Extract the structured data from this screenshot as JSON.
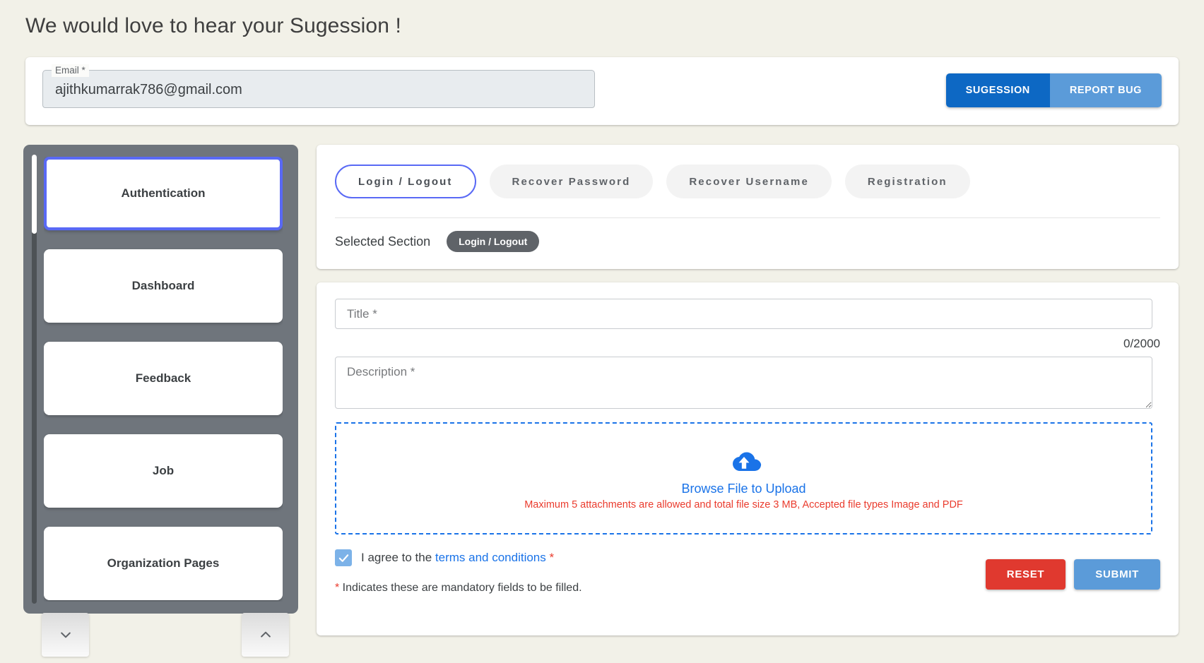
{
  "header": {
    "title": "We would love to hear your Sugession !"
  },
  "email_field": {
    "label": "Email *",
    "value": "ajithkumarrak786@gmail.com"
  },
  "mode_toggle": {
    "suggestion_label": "SUGESSION",
    "report_bug_label": "REPORT BUG",
    "active": "SUGESSION",
    "active_color": "#0d68c4",
    "inactive_color": "#5b9bd9"
  },
  "sidebar": {
    "items": [
      {
        "label": "Authentication",
        "active": true
      },
      {
        "label": "Dashboard",
        "active": false
      },
      {
        "label": "Feedback",
        "active": false
      },
      {
        "label": "Job",
        "active": false
      },
      {
        "label": "Organization Pages",
        "active": false
      }
    ],
    "active_border_color": "#5969f5",
    "background_color": "#6f757c",
    "scroll_down_icon": "chevron-down-icon",
    "scroll_up_icon": "chevron-up-icon"
  },
  "tabs": {
    "items": [
      {
        "label": "Login / Logout",
        "active": true
      },
      {
        "label": "Recover Password",
        "active": false
      },
      {
        "label": "Recover Username",
        "active": false
      },
      {
        "label": "Registration",
        "active": false
      }
    ],
    "selected_section_label": "Selected Section",
    "selected_section_value": "Login / Logout"
  },
  "form": {
    "title_placeholder": "Title *",
    "title_value": "",
    "counter": "0/2000",
    "description_placeholder": "Description *",
    "description_value": "",
    "upload": {
      "icon": "cloud-upload-icon",
      "browse_label": "Browse File to Upload",
      "hint": "Maximum 5 attachments are allowed and total file size 3 MB, Accepted file types Image and PDF",
      "hint_color": "#ea3b2d",
      "border_color": "#1a73e8"
    },
    "agree": {
      "checked": true,
      "prefix": "I agree to the ",
      "link_label": "terms and conditions",
      "required_mark": "*"
    },
    "mandatory_note_star": "*",
    "mandatory_note": " Indicates these are mandatory fields to be filled.",
    "reset_label": "RESET",
    "submit_label": "SUBMIT",
    "reset_color": "#e0392f",
    "submit_color": "#5b9bd9"
  }
}
